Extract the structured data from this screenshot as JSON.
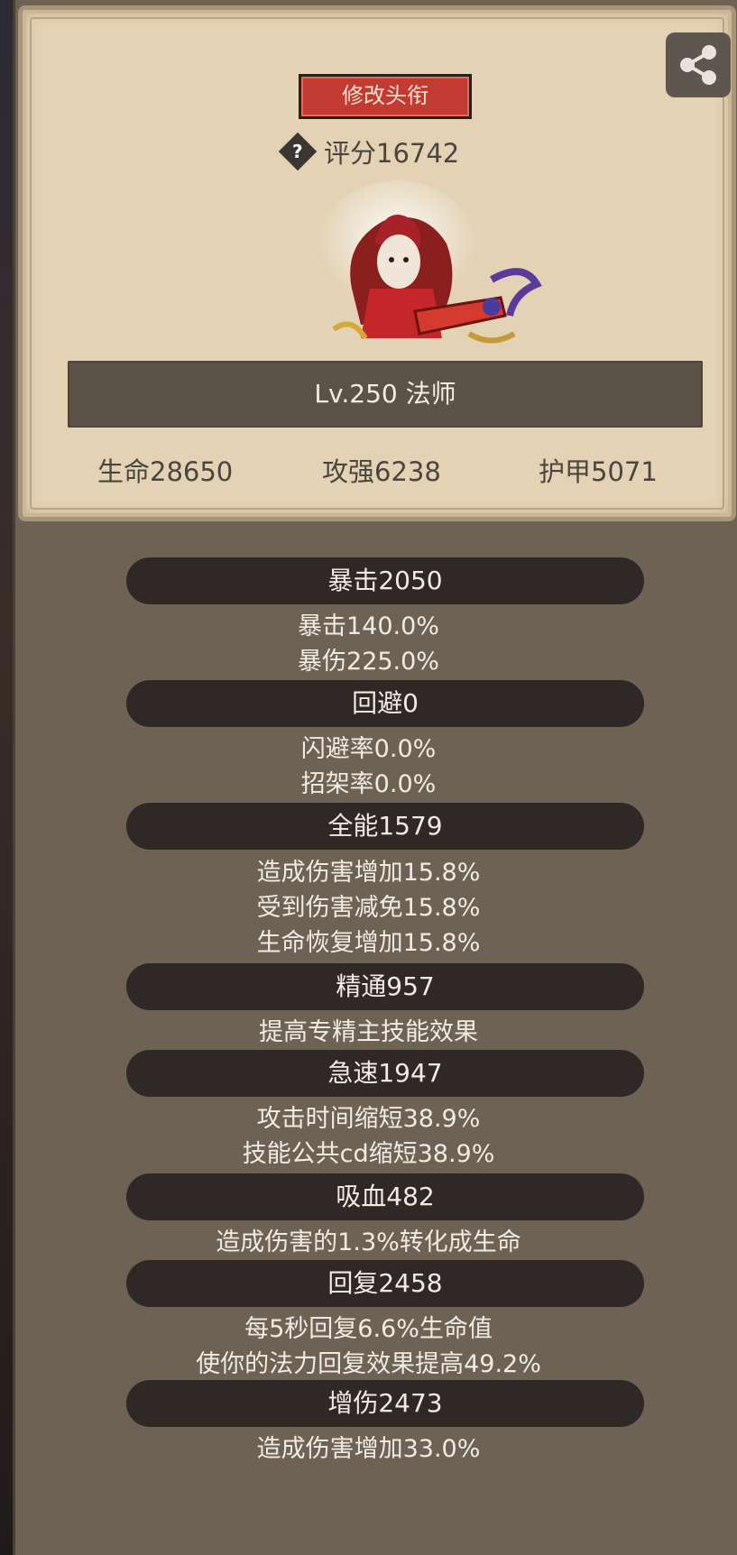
{
  "header": {
    "title_button": "修改头衔",
    "score_icon": "question-diamond-icon",
    "score_label": "评分16742",
    "share_icon": "share-icon"
  },
  "hero": {
    "level_class": "Lv.250 法师"
  },
  "base_stats": [
    {
      "label": "生命28650"
    },
    {
      "label": "攻强6238"
    },
    {
      "label": "护甲5071"
    }
  ],
  "sections": [
    {
      "title": "暴击2050",
      "details": [
        "暴击140.0%",
        "暴伤225.0%"
      ]
    },
    {
      "title": "回避0",
      "details": [
        "闪避率0.0%",
        "招架率0.0%"
      ]
    },
    {
      "title": "全能1579",
      "details": [
        "造成伤害增加15.8%",
        "受到伤害减免15.8%",
        "生命恢复增加15.8%"
      ]
    },
    {
      "title": "精通957",
      "details": [
        "提高专精主技能效果"
      ]
    },
    {
      "title": "急速1947",
      "details": [
        "攻击时间缩短38.9%",
        "技能公共cd缩短38.9%"
      ]
    },
    {
      "title": "吸血482",
      "details": [
        "造成伤害的1.3%转化成生命"
      ]
    },
    {
      "title": "回复2458",
      "details": [
        "每5秒回复6.6%生命值",
        "使你的法力回复效果提高49.2%"
      ]
    },
    {
      "title": "增伤2473",
      "details": [
        "造成伤害增加33.0%"
      ]
    }
  ],
  "colors": {
    "card_bg": "#e3d2b4",
    "panel_bg": "#6e6255",
    "button_red": "#c23a32",
    "pill_dark": "#2e2926"
  }
}
